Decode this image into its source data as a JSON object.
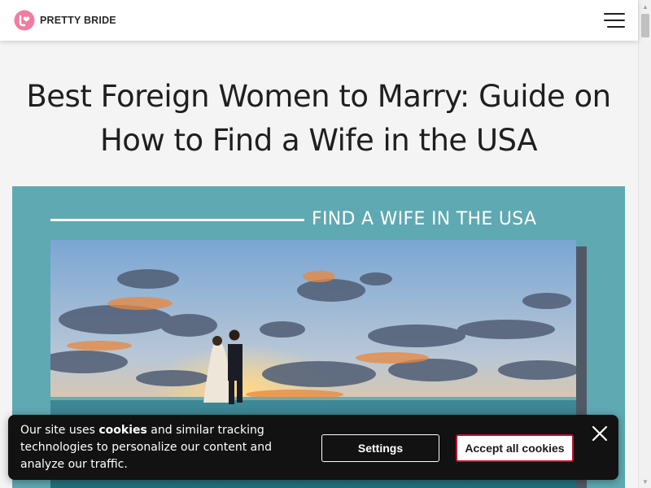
{
  "header": {
    "brand_name": "PRETTY BRIDE",
    "logo_icon": "heart-badge-icon",
    "menu_icon": "hamburger-menu-icon"
  },
  "article": {
    "title": "Best Foreign Women to Marry: Guide on How to Find a Wife in the USA"
  },
  "hero": {
    "caption": "FIND A WIFE IN THE USA",
    "background_color": "#5ea9b2",
    "photo_description_icon": "beach-couple-photo"
  },
  "cookie_banner": {
    "text_before": "Our site uses ",
    "text_bold": "cookies",
    "text_after": " and similar tracking technologies to personalize our content and analyze our traffic.",
    "settings_label": "Settings",
    "accept_label": "Accept all cookies",
    "close_icon": "close-icon",
    "accent_color": "#c4122f"
  },
  "colors": {
    "brand_pink": "#f07d9f",
    "banner_bg": "#121212"
  }
}
